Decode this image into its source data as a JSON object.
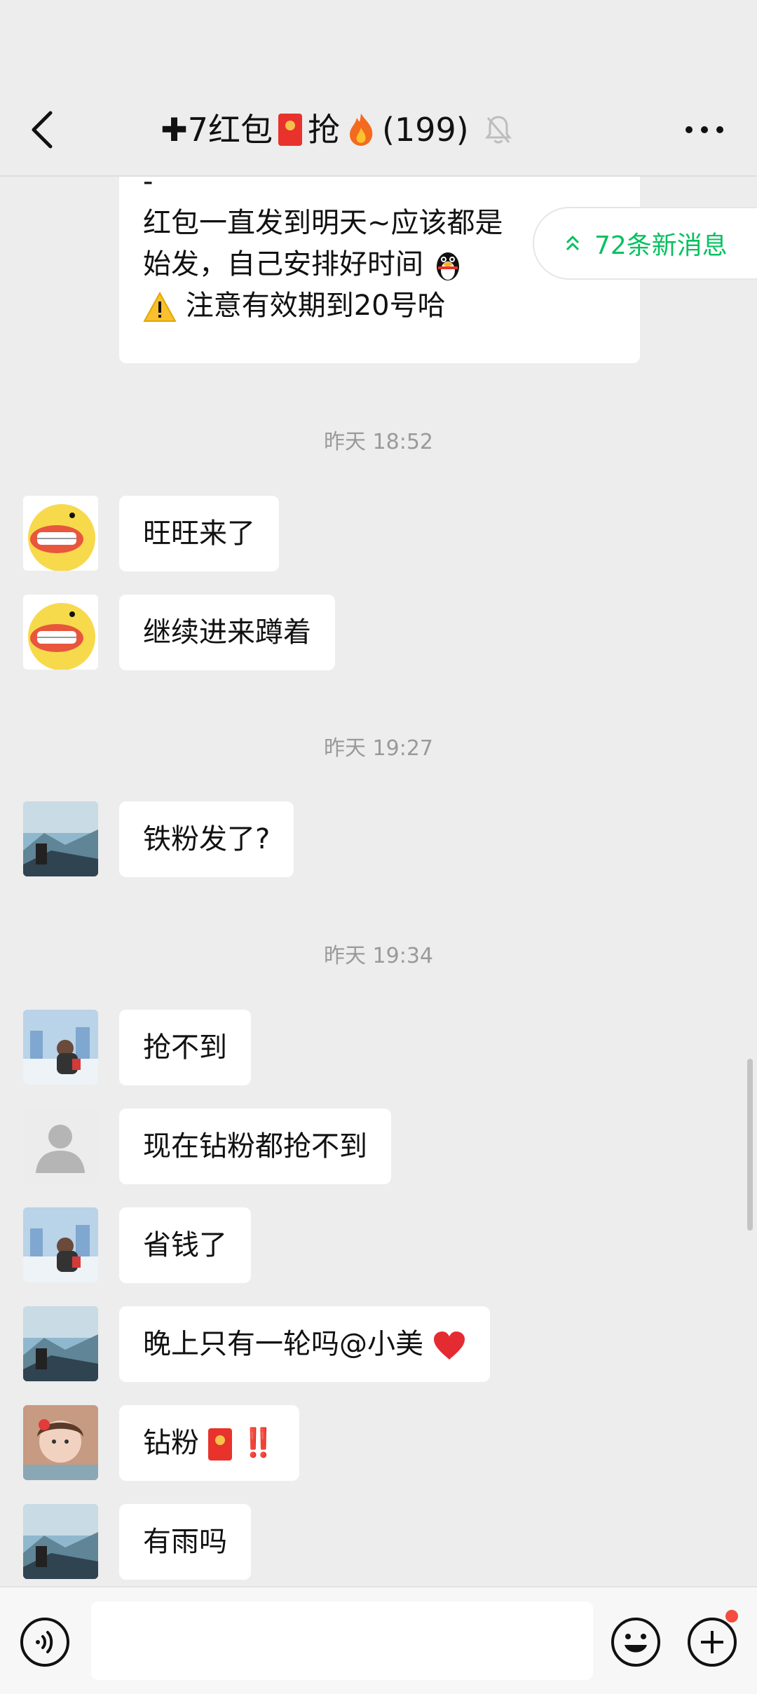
{
  "header": {
    "title_prefix": "✚7红包",
    "title_middle": "抢",
    "title_suffix": "(199)"
  },
  "new_messages": {
    "label": "72条新消息"
  },
  "messages": [
    {
      "type": "text",
      "lines": [
        "-",
        "红包一直发到明天~应该都是",
        "始发，自己安排好时间",
        "注意有效期到20号哈"
      ]
    },
    {
      "type": "time",
      "text": "昨天 18:52"
    },
    {
      "type": "text",
      "text": "旺旺来了",
      "avatar": "duck"
    },
    {
      "type": "text",
      "text": "继续进来蹲着",
      "avatar": "duck"
    },
    {
      "type": "time",
      "text": "昨天 19:27"
    },
    {
      "type": "text",
      "text": "铁粉发了?",
      "avatar": "mountain"
    },
    {
      "type": "time",
      "text": "昨天 19:34"
    },
    {
      "type": "text",
      "text": "抢不到",
      "avatar": "snow-castle"
    },
    {
      "type": "text",
      "text": "现在钻粉都抢不到",
      "avatar": "default-person"
    },
    {
      "type": "text",
      "text": "省钱了",
      "avatar": "snow-castle"
    },
    {
      "type": "text",
      "text": "晚上只有一轮吗@小美",
      "avatar": "mountain"
    },
    {
      "type": "text",
      "text": "钻粉",
      "avatar": "girl"
    },
    {
      "type": "text",
      "text": "有雨吗",
      "avatar": "mountain"
    }
  ],
  "emojis": {
    "red_envelope": "red-envelope-icon",
    "fire": "fire-icon",
    "penguin": "penguin-icon",
    "warning": "warning-icon",
    "heart": "heart-icon",
    "exclamation": "‼️"
  },
  "colors": {
    "background": "#ededed",
    "bubble": "#ffffff",
    "accent_green": "#07c160",
    "timestamp": "#9a9a9a"
  }
}
